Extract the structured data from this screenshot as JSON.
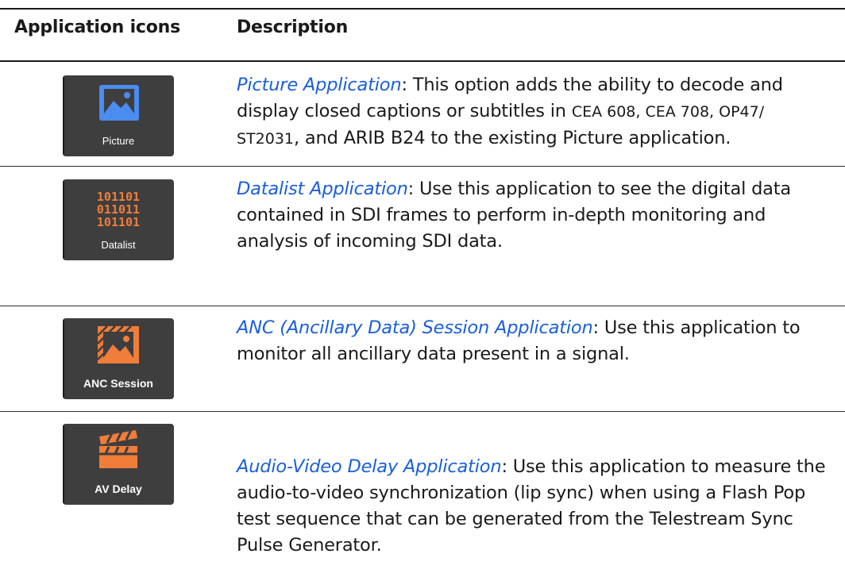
{
  "table": {
    "headers": {
      "icons": "Application icons",
      "description": "Description"
    },
    "rows": [
      {
        "icon": "picture-icon",
        "tile_label": "Picture",
        "link": "Picture Application",
        "text_1": ": This option adds the ability to decode and display closed captions or subtitles in ",
        "text_small": "CEA 608, CEA 708, OP47/ ST2031",
        "text_2": ", and ARIB B24 to the existing Picture application."
      },
      {
        "icon": "datalist-icon",
        "tile_label": "Datalist",
        "binary": [
          "101101",
          "011011",
          "101101"
        ],
        "link": "Datalist Application",
        "text_1": ": Use this application to see the digital data contained in SDI frames to perform in-depth monitoring and analysis of incoming SDI data."
      },
      {
        "icon": "anc-session-icon",
        "tile_label": "ANC Session",
        "link": "ANC (Ancillary Data) Session Application",
        "text_1": ": Use this application to monitor all ancillary data present in a signal."
      },
      {
        "icon": "av-delay-icon",
        "tile_label": "AV Delay",
        "link": "Audio-Video Delay Application",
        "text_1": ": Use this application to measure the audio-to-video synchronization (lip sync) when using a Flash Pop test sequence that can be generated from the Telestream Sync Pulse Generator."
      }
    ]
  },
  "colors": {
    "link": "#1a5fd8",
    "tile_bg": "#3e3e3e",
    "picture_blue": "#4a8cf0",
    "accent_orange": "#f07d3a"
  }
}
